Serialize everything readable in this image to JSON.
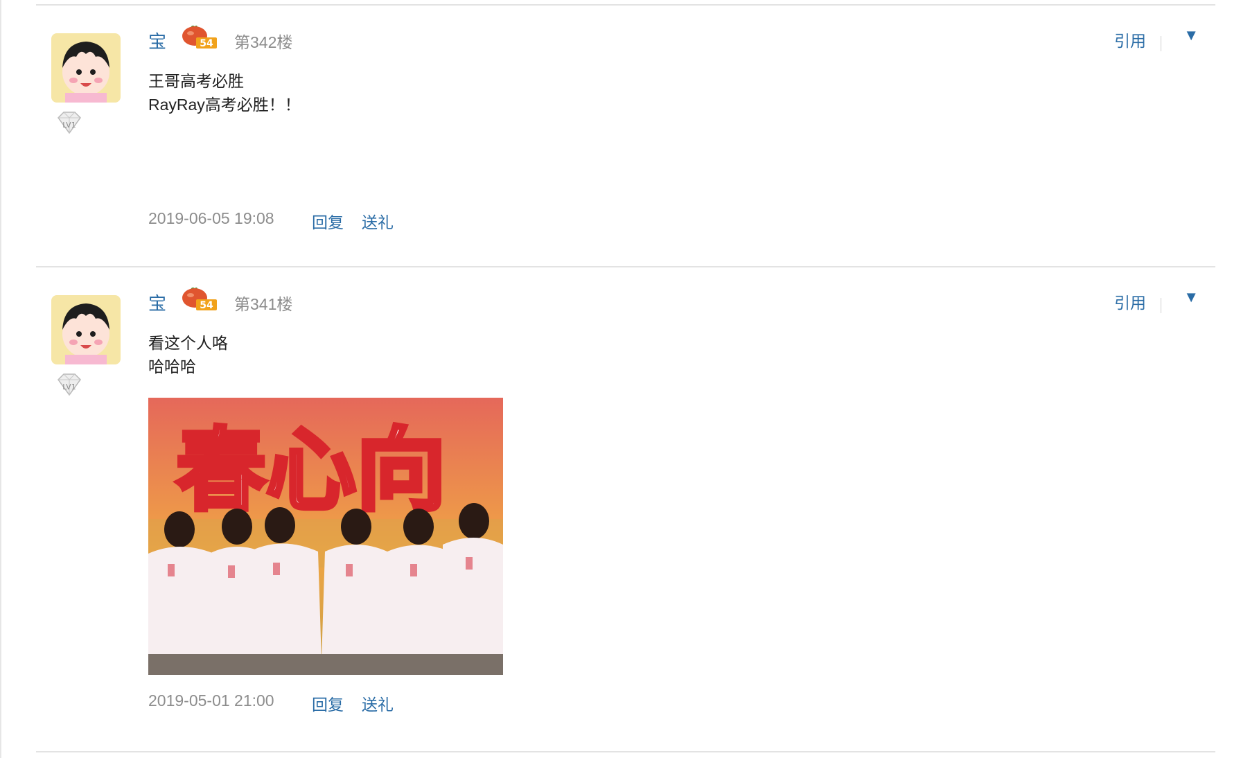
{
  "posts": [
    {
      "author": "宝",
      "floor": "第342楼",
      "quote_label": "引用",
      "more_glyph": "▼",
      "content": [
        "王哥高考必胜",
        "RayRay高考必胜！！"
      ],
      "timestamp": "2019-06-05 19:08",
      "reply_label": "回复",
      "gift_label": "送礼",
      "level_label": "LV1",
      "badge_label": "54"
    },
    {
      "author": "宝",
      "floor": "第341楼",
      "quote_label": "引用",
      "more_glyph": "▼",
      "content": [
        "看这个人咯",
        "哈哈哈"
      ],
      "timestamp": "2019-05-01 21:00",
      "reply_label": "回复",
      "gift_label": "送礼",
      "level_label": "LV1",
      "badge_label": "54",
      "image_caption_text": "春心向"
    }
  ],
  "colors": {
    "link": "#2a6ca6",
    "meta": "#8c8c8c",
    "text": "#222222",
    "divider": "#e3e3e3"
  },
  "icons": {
    "avatar": "cartoon-girl-avatar",
    "level": "diamond-level-icon",
    "badge": "tomato-badge-icon",
    "more": "triangle-down-icon"
  }
}
